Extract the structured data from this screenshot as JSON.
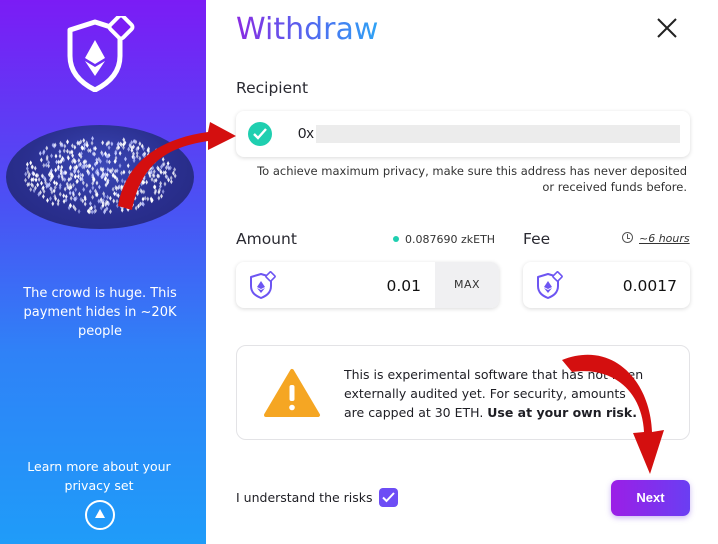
{
  "left_panel": {
    "crowd_caption": "The crowd is huge. This payment hides in ~20K people",
    "learn_more": "Learn more about your privacy set",
    "logo_icon": "shield-ethereum-icon",
    "learn_more_icon": "up-circle-icon"
  },
  "header": {
    "title": "Withdraw",
    "close_icon": "close-icon"
  },
  "recipient": {
    "label": "Recipient",
    "prefix": "0x",
    "value": "",
    "status_icon": "check-circle-icon",
    "note": "To achieve maximum privacy, make sure this address has never deposited or received funds before."
  },
  "amount": {
    "label": "Amount",
    "balance": "0.087690 zkETH",
    "value": "0.01",
    "max_label": "MAX",
    "token_icon": "shield-ethereum-icon"
  },
  "fee": {
    "label": "Fee",
    "duration": "~6 hours",
    "value": "0.0017",
    "token_icon": "shield-ethereum-icon"
  },
  "warning": {
    "icon": "warning-triangle-icon",
    "text": "This is experimental software that has not been externally audited yet. For security, amounts are capped at 30 ETH. ",
    "emphasis": "Use at your own risk."
  },
  "consent": {
    "label": "I understand the risks",
    "checked": true
  },
  "actions": {
    "next_label": "Next"
  },
  "colors": {
    "accent": "#6d4df5",
    "teal": "#1fcfb0",
    "warning": "#f5a623",
    "annotation_arrow": "#d40f0f"
  }
}
